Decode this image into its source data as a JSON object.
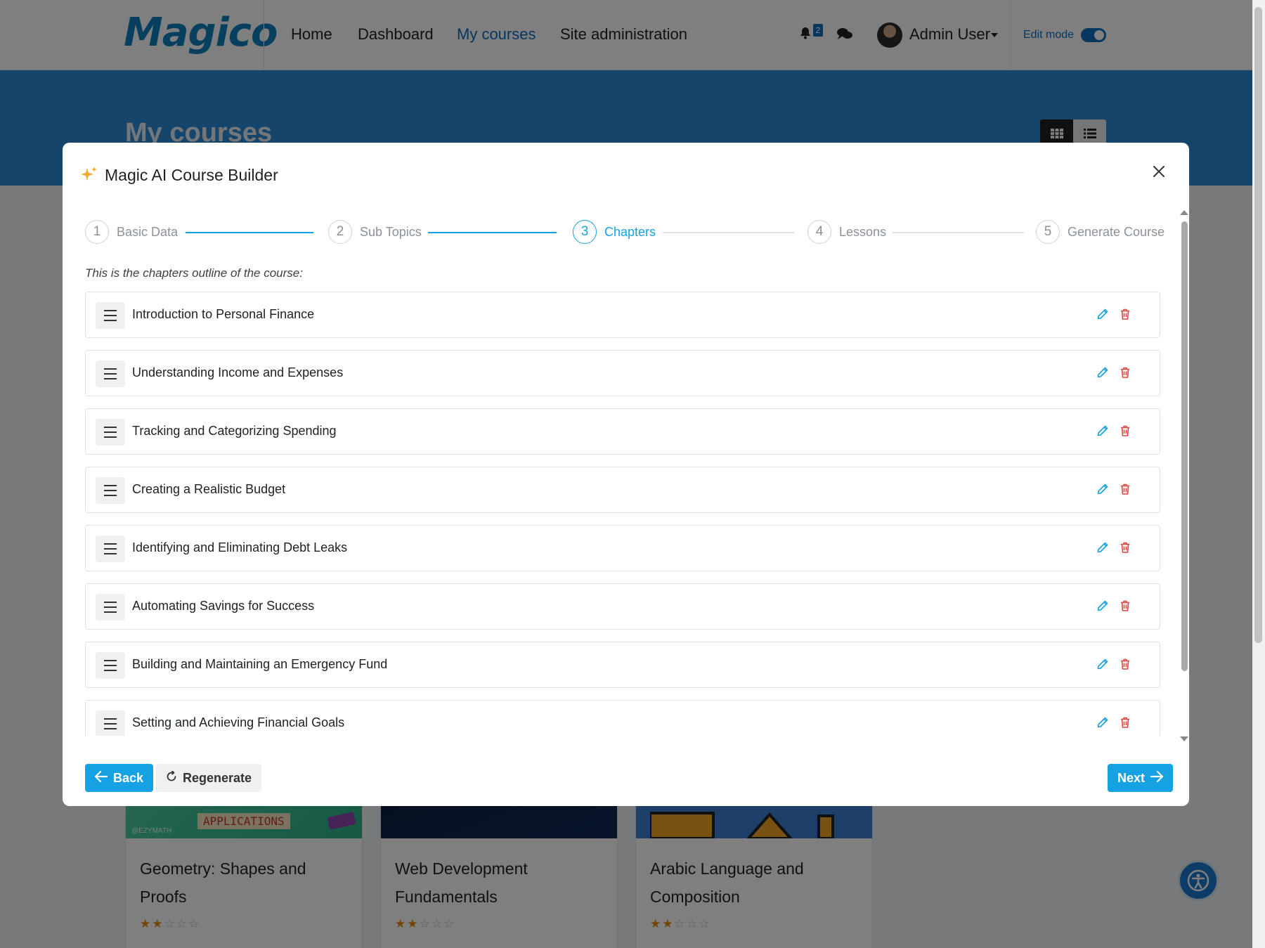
{
  "nav": {
    "logo": "Magico",
    "links": [
      "Home",
      "Dashboard",
      "My courses",
      "Site administration"
    ],
    "notification_count": "2",
    "user_name": "Admin User",
    "edit_mode_label": "Edit mode",
    "edit_mode_on": true
  },
  "page": {
    "title": "My courses"
  },
  "courses": [
    {
      "title": "Geometry: Shapes and Proofs",
      "image_text": "APPLICATIONS",
      "image_credit": "@EZYMATH",
      "rating": 2,
      "max_rating": 5
    },
    {
      "title": "Web Development Fundamentals",
      "rating": 2,
      "max_rating": 5
    },
    {
      "title": "Arabic Language and Composition",
      "rating": 2,
      "max_rating": 5
    }
  ],
  "modal": {
    "title": "Magic AI Course Builder",
    "icon": "sparkle-icon",
    "steps": [
      {
        "number": "1",
        "label": "Basic Data",
        "state": "done"
      },
      {
        "number": "2",
        "label": "Sub Topics",
        "state": "done"
      },
      {
        "number": "3",
        "label": "Chapters",
        "state": "active"
      },
      {
        "number": "4",
        "label": "Lessons",
        "state": "pending"
      },
      {
        "number": "5",
        "label": "Generate Course",
        "state": "pending"
      }
    ],
    "intro": "This is the chapters outline of the course:",
    "chapters": [
      "Introduction to Personal Finance",
      "Understanding Income and Expenses",
      "Tracking and Categorizing Spending",
      "Creating a Realistic Budget",
      "Identifying and Eliminating Debt Leaks",
      "Automating Savings for Success",
      "Building and Maintaining an Emergency Fund",
      "Setting and Achieving Financial Goals"
    ],
    "buttons": {
      "back": "Back",
      "regenerate": "Regenerate",
      "next": "Next"
    }
  },
  "colors": {
    "accent": "#16a1e3",
    "brand": "#0f6cbf",
    "delete": "#e0443e",
    "star": "#e08a0b"
  }
}
